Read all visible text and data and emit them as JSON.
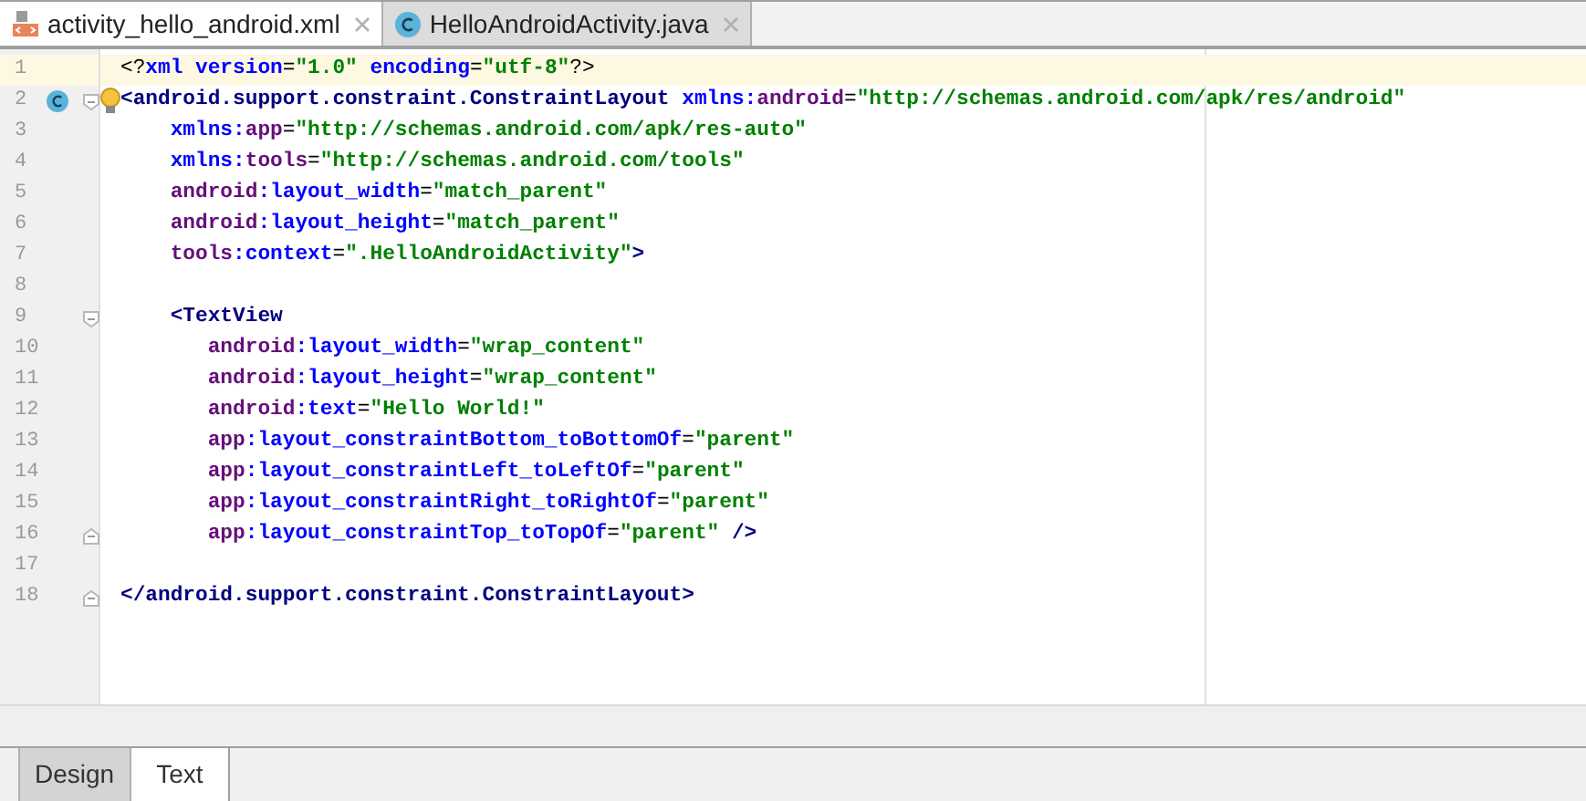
{
  "editor_tabs": [
    {
      "label": "activity_hello_android.xml",
      "kind": "xml",
      "selected": true
    },
    {
      "label": "HelloAndroidActivity.java",
      "kind": "class",
      "selected": false
    }
  ],
  "code_lines": [
    {
      "number": "1",
      "current": true,
      "tokens": [
        {
          "t": "<?",
          "kind": "punct"
        },
        {
          "t": "xml ",
          "kind": "attr"
        },
        {
          "t": "version",
          "kind": "attr"
        },
        {
          "t": "=",
          "kind": "punct"
        },
        {
          "t": "\"1.0\"",
          "kind": "value"
        },
        {
          "t": " encoding",
          "kind": "attr"
        },
        {
          "t": "=",
          "kind": "punct"
        },
        {
          "t": "\"utf-8\"",
          "kind": "value"
        },
        {
          "t": "?>",
          "kind": "punct"
        }
      ]
    },
    {
      "number": "2",
      "current": false,
      "fold_start": true,
      "class_marker": true,
      "bulb": true,
      "tokens": [
        {
          "t": "<android.support.constraint.ConstraintLayout ",
          "kind": "tag"
        },
        {
          "t": "xmlns:",
          "kind": "attr"
        },
        {
          "t": "android",
          "kind": "ns"
        },
        {
          "t": "=",
          "kind": "punct"
        },
        {
          "t": "\"http://schemas.android.com/apk/res/android\"",
          "kind": "value"
        }
      ]
    },
    {
      "number": "3",
      "current": false,
      "tokens": [
        {
          "t": "    xmlns:",
          "kind": "attr"
        },
        {
          "t": "app",
          "kind": "ns"
        },
        {
          "t": "=",
          "kind": "punct"
        },
        {
          "t": "\"http://schemas.android.com/apk/res-auto\"",
          "kind": "value"
        }
      ]
    },
    {
      "number": "4",
      "current": false,
      "tokens": [
        {
          "t": "    xmlns:",
          "kind": "attr"
        },
        {
          "t": "tools",
          "kind": "ns"
        },
        {
          "t": "=",
          "kind": "punct"
        },
        {
          "t": "\"http://schemas.android.com/tools\"",
          "kind": "value"
        }
      ]
    },
    {
      "number": "5",
      "current": false,
      "tokens": [
        {
          "t": "    android",
          "kind": "ns"
        },
        {
          "t": ":layout_width",
          "kind": "attr"
        },
        {
          "t": "=",
          "kind": "punct"
        },
        {
          "t": "\"match_parent\"",
          "kind": "value"
        }
      ]
    },
    {
      "number": "6",
      "current": false,
      "tokens": [
        {
          "t": "    android",
          "kind": "ns"
        },
        {
          "t": ":layout_height",
          "kind": "attr"
        },
        {
          "t": "=",
          "kind": "punct"
        },
        {
          "t": "\"match_parent\"",
          "kind": "value"
        }
      ]
    },
    {
      "number": "7",
      "current": false,
      "tokens": [
        {
          "t": "    tools",
          "kind": "ns"
        },
        {
          "t": ":context",
          "kind": "attr"
        },
        {
          "t": "=",
          "kind": "punct"
        },
        {
          "t": "\".HelloAndroidActivity\"",
          "kind": "value"
        },
        {
          "t": ">",
          "kind": "tag"
        }
      ]
    },
    {
      "number": "8",
      "current": false
    },
    {
      "number": "9",
      "current": false,
      "fold_start": true,
      "tokens": [
        {
          "t": "    <TextView",
          "kind": "tag"
        }
      ]
    },
    {
      "number": "10",
      "current": false,
      "tokens": [
        {
          "t": "       android",
          "kind": "ns"
        },
        {
          "t": ":layout_width",
          "kind": "attr"
        },
        {
          "t": "=",
          "kind": "punct"
        },
        {
          "t": "\"wrap_content\"",
          "kind": "value"
        }
      ]
    },
    {
      "number": "11",
      "current": false,
      "tokens": [
        {
          "t": "       android",
          "kind": "ns"
        },
        {
          "t": ":layout_height",
          "kind": "attr"
        },
        {
          "t": "=",
          "kind": "punct"
        },
        {
          "t": "\"wrap_content\"",
          "kind": "value"
        }
      ]
    },
    {
      "number": "12",
      "current": false,
      "tokens": [
        {
          "t": "       android",
          "kind": "ns"
        },
        {
          "t": ":text",
          "kind": "attr"
        },
        {
          "t": "=",
          "kind": "punct"
        },
        {
          "t": "\"Hello World!\"",
          "kind": "value"
        }
      ]
    },
    {
      "number": "13",
      "current": false,
      "tokens": [
        {
          "t": "       app",
          "kind": "ns"
        },
        {
          "t": ":layout_constraintBottom_toBottomOf",
          "kind": "attr"
        },
        {
          "t": "=",
          "kind": "punct"
        },
        {
          "t": "\"parent\"",
          "kind": "value"
        }
      ]
    },
    {
      "number": "14",
      "current": false,
      "tokens": [
        {
          "t": "       app",
          "kind": "ns"
        },
        {
          "t": ":layout_constraintLeft_toLeftOf",
          "kind": "attr"
        },
        {
          "t": "=",
          "kind": "punct"
        },
        {
          "t": "\"parent\"",
          "kind": "value"
        }
      ]
    },
    {
      "number": "15",
      "current": false,
      "tokens": [
        {
          "t": "       app",
          "kind": "ns"
        },
        {
          "t": ":layout_constraintRight_toRightOf",
          "kind": "attr"
        },
        {
          "t": "=",
          "kind": "punct"
        },
        {
          "t": "\"parent\"",
          "kind": "value"
        }
      ]
    },
    {
      "number": "16",
      "current": false,
      "fold_end": true,
      "tokens": [
        {
          "t": "       app",
          "kind": "ns"
        },
        {
          "t": ":layout_constraintTop_toTopOf",
          "kind": "attr"
        },
        {
          "t": "=",
          "kind": "punct"
        },
        {
          "t": "\"parent\"",
          "kind": "value"
        },
        {
          "t": " />",
          "kind": "tag"
        }
      ]
    },
    {
      "number": "17",
      "current": false
    },
    {
      "number": "18",
      "current": false,
      "fold_end": true,
      "tokens": [
        {
          "t": "</android.support.constraint.ConstraintLayout>",
          "kind": "tag"
        }
      ]
    }
  ],
  "bottom_tabs": [
    {
      "label": "Design",
      "selected": false
    },
    {
      "label": "Text",
      "selected": true
    }
  ]
}
